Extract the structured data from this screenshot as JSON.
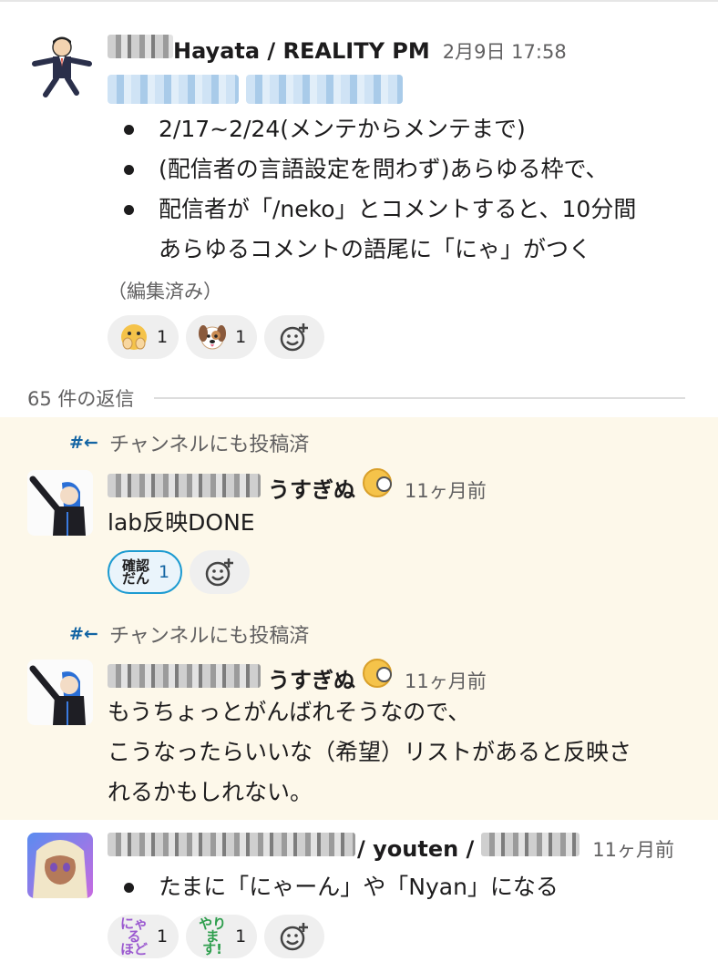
{
  "messages": [
    {
      "author": "Hayata / REALITY PM",
      "timestamp": "2月9日 17:58",
      "bullets": [
        "2/17~2/24(メンテからメンテまで)",
        "(配信者の言語設定を問わず)あらゆる枠で、",
        "配信者が「/neko」とコメントすると、10分間",
        "あらゆるコメントの語尾に「にゃ」がつく"
      ],
      "edited_label": "（編集済み）",
      "reactions": [
        {
          "emoji": "face-with-hands-icon",
          "count": "1"
        },
        {
          "emoji": "dog-face-icon",
          "count": "1"
        }
      ]
    }
  ],
  "thread": {
    "reply_count_label": "65 件の返信"
  },
  "replies": [
    {
      "also_posted": "チャンネルにも投稿済",
      "author": "うすぎぬ",
      "timestamp": "11ヶ月前",
      "text": "lab反映DONE",
      "reaction": {
        "label": "確認だん",
        "label_line1": "確認",
        "label_line2": "だん",
        "count": "1"
      }
    },
    {
      "also_posted": "チャンネルにも投稿済",
      "author": "うすぎぬ",
      "timestamp": "11ヶ月前",
      "lines": [
        "もうちょっとがんばれそうなので、",
        "こうなったらいいな（希望）リストがあると反映さ",
        "れるかもしれない。"
      ]
    },
    {
      "author": "/ youten /",
      "timestamp": "11ヶ月前",
      "bullets": [
        "たまに「にゃーん」や「Nyan」になる"
      ],
      "reactions": [
        {
          "label_line1": "にゃる",
          "label_line2": "ほど",
          "count": "1",
          "color": "#9b59d0"
        },
        {
          "label_line1": "やり",
          "label_line2": "ます!",
          "count": "1",
          "color": "#2e9e4d"
        }
      ]
    }
  ],
  "colors": {
    "link_blue": "#1264a3",
    "highlight_bg": "#fdf8ea",
    "reaction_active_border": "#1d9bd1"
  }
}
